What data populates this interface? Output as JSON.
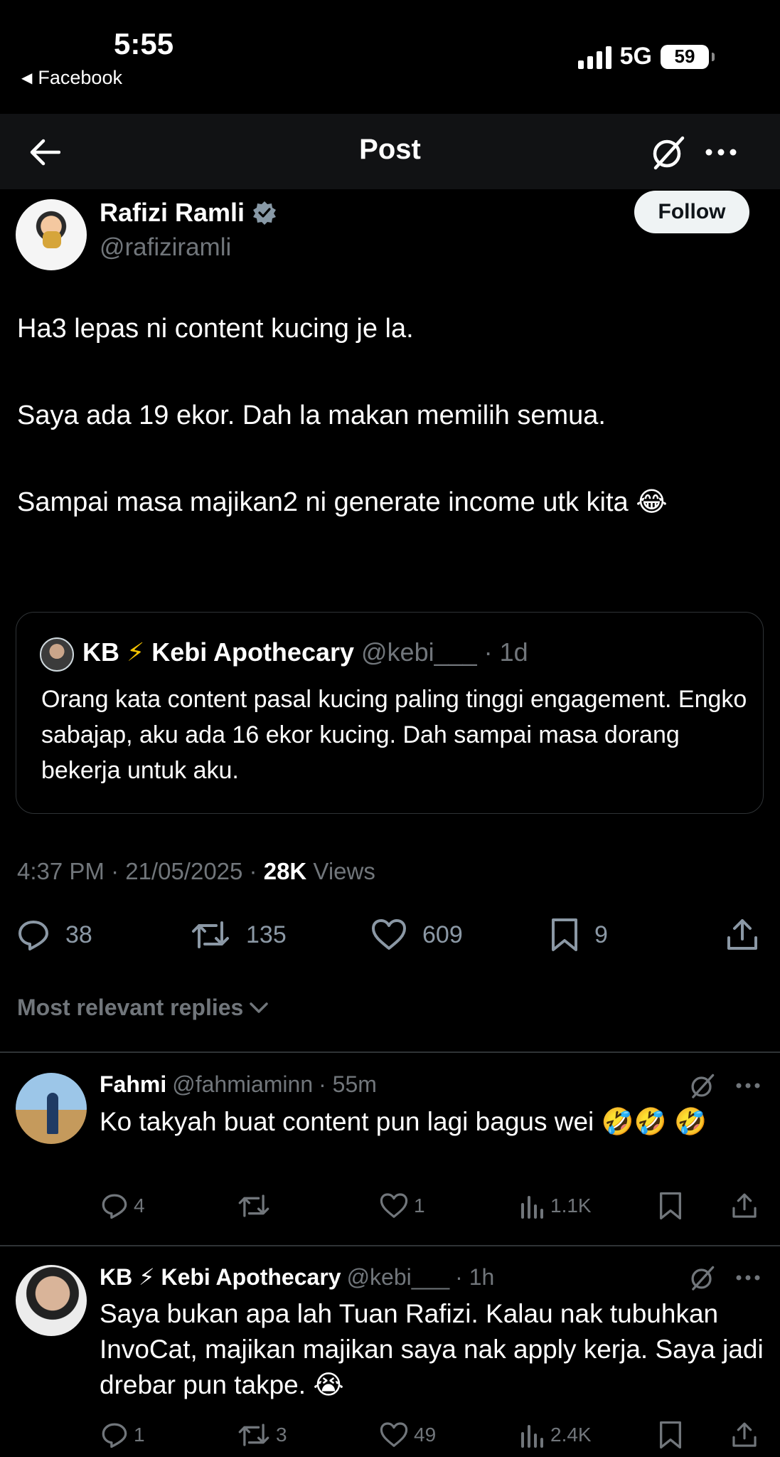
{
  "status_bar": {
    "time": "5:55",
    "back_app": "Facebook",
    "network": "5G",
    "battery": "59"
  },
  "header": {
    "title": "Post"
  },
  "post": {
    "author_name": "Rafizi Ramli",
    "author_handle": "@rafiziramli",
    "follow_label": "Follow",
    "paragraphs": [
      "Ha3 lepas ni content kucing je la.",
      "Saya ada 19 ekor. Dah la makan memilih semua.",
      "Sampai masa majikan2 ni generate income utk kita 😂"
    ],
    "quote": {
      "initials": "KB",
      "bolt": "⚡",
      "name": "Kebi Apothecary",
      "handle": "@kebi___",
      "age": "· 1d",
      "text": "Orang kata content pasal kucing paling tinggi engagement. Engko sabajap, aku ada 16 ekor kucing. Dah sampai masa dorang bekerja untuk aku."
    },
    "timestamp": "4:37 PM · 21/05/2025 · ",
    "views_count": "28K",
    "views_label": " Views",
    "stats": {
      "replies": "38",
      "reposts": "135",
      "likes": "609",
      "bookmarks": "9"
    }
  },
  "sort": {
    "label": "Most relevant replies"
  },
  "replies": [
    {
      "name": "Fahmi",
      "handle": "@fahmiaminn",
      "age": "· 55m",
      "text": "Ko takyah buat content pun lagi bagus wei 🤣🤣 🤣",
      "replies": "4",
      "reposts": "",
      "likes": "1",
      "views": "1.1K"
    },
    {
      "name": "KB ⚡ Kebi Apothecary",
      "handle": "@kebi___",
      "age": "· 1h",
      "text": "Saya bukan apa lah Tuan Rafizi. Kalau nak tubuhkan InvoCat, majikan majikan saya nak apply kerja. Saya jadi drebar pun takpe. 😭",
      "replies": "1",
      "reposts": "3",
      "likes": "49",
      "views": "2.4K"
    }
  ],
  "icons": {
    "back": "arrow-left-icon",
    "grok": "grok-icon",
    "more": "more-horizontal-icon",
    "verified": "verified-badge-icon",
    "reply": "reply-icon",
    "repost": "repost-icon",
    "like": "heart-icon",
    "bookmark": "bookmark-icon",
    "share": "share-icon",
    "views": "views-chart-icon",
    "chevron": "chevron-down-icon"
  },
  "colors": {
    "background": "#000000",
    "text": "#e7e9ea",
    "muted": "#71767b",
    "divider": "#2f3336",
    "verified": "#8899a6",
    "follow_bg": "#eff3f4"
  }
}
